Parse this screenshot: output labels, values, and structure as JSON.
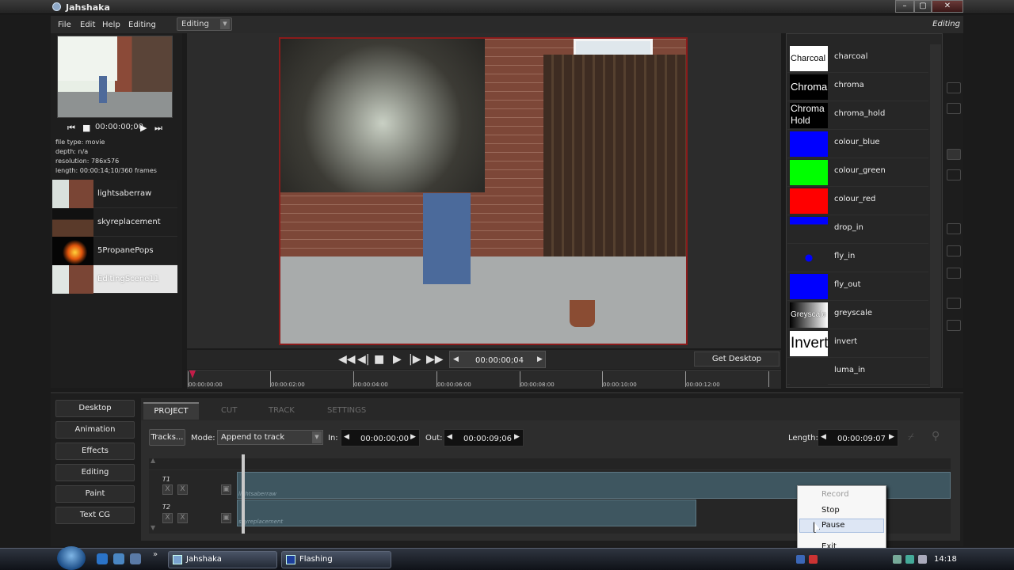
{
  "window": {
    "title": "Jahshaka",
    "min": "–",
    "max": "▢",
    "close": "✕"
  },
  "menu": {
    "items": [
      "File",
      "Edit",
      "Help",
      "Editing"
    ],
    "mode": "Editing",
    "mode_right": "Editing"
  },
  "preview": {
    "time": "00:00:00;00",
    "info": [
      "file type: movie",
      "depth: n/a",
      "resolution: 786x576",
      "length: 00:00:14;10/360 frames"
    ]
  },
  "clips": [
    {
      "name": "lightsaberraw"
    },
    {
      "name": "skyreplacement"
    },
    {
      "name": "5PropanePops"
    },
    {
      "name": "EditingScene11"
    }
  ],
  "transport": {
    "timecode": "00:00:00;04",
    "get_desktop": "Get Desktop",
    "ruler_labels": [
      "00:00:00:00",
      "00:00:02:00",
      "00:00:04:00",
      "00:00:06:00",
      "00:00:08:00",
      "00:00:10:00",
      "00:00:12:00"
    ]
  },
  "effects": [
    {
      "name": "charcoal",
      "swatch": "Charcoal",
      "color": "#ffffff"
    },
    {
      "name": "chroma",
      "swatch": "Chroma",
      "color": "#ffffff"
    },
    {
      "name": "chroma_hold",
      "swatch": "Chroma Hold",
      "color": "#ffffff"
    },
    {
      "name": "colour_blue",
      "swatch": "",
      "color": "#0000ff"
    },
    {
      "name": "colour_green",
      "swatch": "",
      "color": "#00ff00"
    },
    {
      "name": "colour_red",
      "swatch": "",
      "color": "#ff0000"
    },
    {
      "name": "drop_in",
      "swatch": "",
      "color": "#262626"
    },
    {
      "name": "fly_in",
      "swatch": "",
      "color": "#262626"
    },
    {
      "name": "fly_out",
      "swatch": "",
      "color": "#0000ff"
    },
    {
      "name": "greyscale",
      "swatch": "Greyscale",
      "color": "#ffffff"
    },
    {
      "name": "invert",
      "swatch": "Invert",
      "color": "#ffffff"
    },
    {
      "name": "luma_in",
      "swatch": "",
      "color": "#262626"
    }
  ],
  "sidebar": {
    "buttons": [
      "Desktop",
      "Animation",
      "Effects",
      "Editing",
      "Paint",
      "Text CG"
    ]
  },
  "tabs": [
    "PROJECT",
    "CUT",
    "TRACK",
    "SETTINGS"
  ],
  "edit": {
    "tracks_button": "Tracks...",
    "mode_label": "Mode:",
    "mode_value": "Append to track",
    "in_label": "In:",
    "in_value": "00:00:00;00",
    "out_label": "Out:",
    "out_value": "00:00:09;06",
    "length_label": "Length:",
    "length_value": "00:00:09:07"
  },
  "timeline": {
    "tracks": [
      {
        "label": "T1",
        "clip": "lightsaberraw"
      },
      {
        "label": "T2",
        "clip": "skyreplacement"
      }
    ]
  },
  "context_menu": {
    "items": [
      "Record",
      "Stop",
      "Pause",
      "Exit"
    ]
  },
  "taskbar": {
    "tasks": [
      "Jahshaka",
      "Flashing"
    ],
    "clock": "14:18"
  }
}
